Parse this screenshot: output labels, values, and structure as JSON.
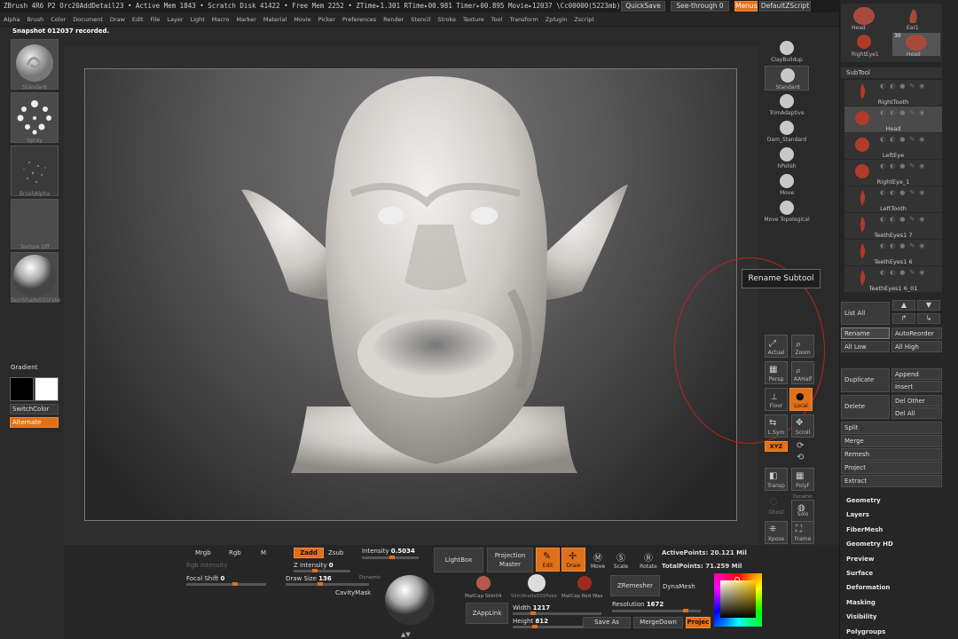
{
  "titlebar": {
    "info": "ZBrush 4R6 P2    Orc20AddDetail23   • Active Mem 1843 • Scratch Disk 41422 • Free Mem 2252 • ZTime▸1.301 RTime▸00.981 Timer▸00.895 Movie▸12037 \\Cc00000(5223mb)",
    "quicksave": "QuickSave",
    "seethrough": "See-through  0",
    "menus": "Menus",
    "defaultzscript": "DefaultZScript"
  },
  "menubar": [
    "Alpha",
    "Brush",
    "Color",
    "Document",
    "Draw",
    "Edit",
    "File",
    "Layer",
    "Light",
    "Macro",
    "Marker",
    "Material",
    "Movie",
    "Picker",
    "Preferences",
    "Render",
    "Stencil",
    "Stroke",
    "Texture",
    "Tool",
    "Transform",
    "Zplugin",
    "Zscript"
  ],
  "snapshot_msg": "Snapshot 012037 recorded.",
  "left_shelf": {
    "brush": "Standard",
    "stroke": "Spray",
    "alpha": "BrushAlpha",
    "texture": "Texture Off",
    "material": "SkinShadeSSSFake",
    "gradient": "Gradient",
    "switchcolor": "SwitchColor",
    "alternate": "Alternate"
  },
  "right_shelf": {
    "brushes": [
      "ClayBuildup",
      "Standard",
      "TrimAdaptive",
      "Dam_Standard",
      "hPolish",
      "Move",
      "Move Topological"
    ],
    "nav": {
      "actual": "Actual",
      "zoom": "Zoom",
      "persp": "Persp",
      "aahalf": "AAHalf",
      "floor": "Floor",
      "local": "Local",
      "lsym": "L.Sym",
      "scroll": "Scroll",
      "xyz": "XYZ",
      "transp": "Transp",
      "polyf": "PolyF",
      "ghost": "Ghost",
      "solo": "Solo",
      "dynamic": "Dynamic",
      "xpose": "Xpose",
      "frame": "Frame"
    }
  },
  "tooltip": "Rename Subtool",
  "bottom": {
    "mrgb": "Mrgb",
    "rgb": "Rgb",
    "m": "M",
    "zadd": "Zadd",
    "zsub": "Zsub",
    "rgb_intensity": "Rgb Intensity",
    "intensity_label": "Intensity",
    "intensity_value": "0.5034",
    "z_intensity_label": "Z Intensity",
    "z_intensity_value": "0",
    "focal_label": "Focal Shift",
    "focal_value": "0",
    "drawsize_label": "Draw Size",
    "drawsize_value": "136",
    "dynamic": "Dynamic",
    "cavitymask": "CavityMask",
    "lightbox": "LightBox",
    "projection_master": "Projection Master",
    "edit": "Edit",
    "draw": "Draw",
    "move": "Move",
    "scale": "Scale",
    "rotate": "Rotate",
    "activepoints_label": "ActivePoints:",
    "activepoints_value": "20.121 Mil",
    "totalpoints_label": "TotalPoints:",
    "totalpoints_value": "71.259 Mil",
    "materials": [
      "MatCap Skin04",
      "SkinShadeSSSFake",
      "MatCap Red Wax"
    ],
    "zremesher": "ZRemesher",
    "dynamesh": "DynaMesh",
    "resolution_label": "Resolution",
    "resolution_value": "1672",
    "zapplink": "ZAppLink",
    "width_label": "Width",
    "width_value": "1217",
    "height_label": "Height",
    "height_value": "812",
    "saveas": "Save As",
    "mergedown": "MergeDown",
    "project": "Projec"
  },
  "rpanel": {
    "top_thumbs": [
      "Head",
      "Ear1",
      "RightEye1",
      "Head"
    ],
    "thumb_count": "30",
    "subtool_title": "SubTool",
    "subtools": [
      "RightTooth",
      "Head",
      "LeftEye",
      "RightEye_1",
      "LeftTooth",
      "TeethEyes1 7",
      "TeethEyes1 6",
      "TeethEyes1 6_01"
    ],
    "list_all": "List All",
    "rename": "Rename",
    "autoreorder": "AutoReorder",
    "all_low": "All Low",
    "all_high": "All High",
    "duplicate": "Duplicate",
    "append": "Append",
    "insert": "Insert",
    "delete": "Delete",
    "del_other": "Del Other",
    "del_all": "Del All",
    "split": "Split",
    "merge": "Merge",
    "remesh": "Remesh",
    "project": "Project",
    "extract": "Extract",
    "categories": [
      "Geometry",
      "Layers",
      "FiberMesh",
      "Geometry HD",
      "Preview",
      "Surface",
      "Deformation",
      "Masking",
      "Visibility",
      "Polygroups"
    ]
  },
  "colors": {
    "accent": "#e0701a",
    "panel": "#262626",
    "button": "#3a3a3a"
  }
}
